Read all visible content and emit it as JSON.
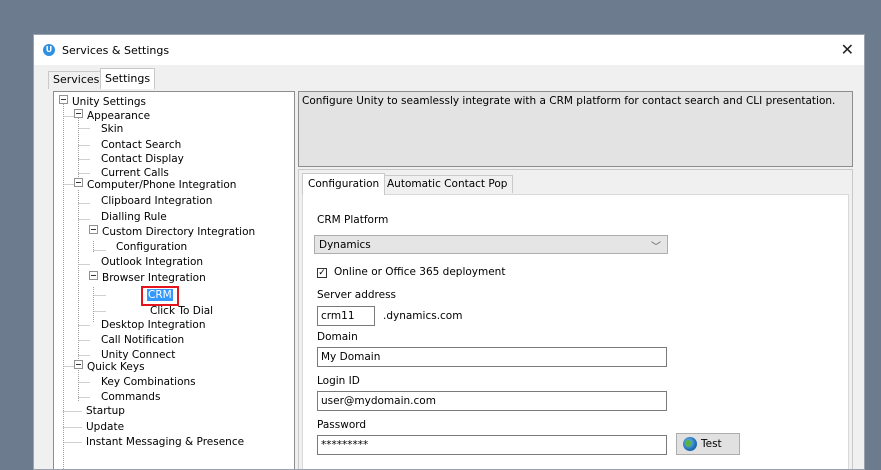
{
  "window": {
    "title": "Services & Settings",
    "app_icon_glyph": "U"
  },
  "top_tabs": [
    {
      "label": "Services"
    },
    {
      "label": "Settings"
    }
  ],
  "tree": {
    "items": [
      {
        "label": "Unity Settings"
      },
      {
        "label": "Appearance"
      },
      {
        "label": "Skin"
      },
      {
        "label": "Contact Search"
      },
      {
        "label": "Contact Display"
      },
      {
        "label": "Current Calls"
      },
      {
        "label": "Computer/Phone Integration"
      },
      {
        "label": "Clipboard Integration"
      },
      {
        "label": "Dialling Rule"
      },
      {
        "label": "Custom Directory Integration"
      },
      {
        "label": "Configuration"
      },
      {
        "label": "Outlook Integration"
      },
      {
        "label": "Browser Integration"
      },
      {
        "label": "CRM"
      },
      {
        "label": "Click To Dial"
      },
      {
        "label": "Desktop Integration"
      },
      {
        "label": "Call Notification"
      },
      {
        "label": "Unity Connect"
      },
      {
        "label": "Quick Keys"
      },
      {
        "label": "Key Combinations"
      },
      {
        "label": "Commands"
      },
      {
        "label": "Startup"
      },
      {
        "label": "Update"
      },
      {
        "label": "Instant Messaging & Presence"
      }
    ]
  },
  "description": "Configure Unity to seamlessly integrate with a CRM platform for contact search and CLI presentation.",
  "inner_tabs": [
    {
      "label": "Configuration"
    },
    {
      "label": "Automatic Contact Pop"
    }
  ],
  "config": {
    "crm_platform_label": "CRM Platform",
    "crm_platform_value": "Dynamics",
    "online_checkbox_label": "Online or Office 365 deployment",
    "online_checked": true,
    "server_address_label": "Server address",
    "server_address_value": "crm11",
    "server_suffix": ".dynamics.com",
    "domain_label": "Domain",
    "domain_value": "My Domain",
    "login_label": "Login ID",
    "login_value": "user@mydomain.com",
    "password_label": "Password",
    "password_value": "*********",
    "test_button_label": "Test"
  },
  "colors": {
    "selection": "#3399ff",
    "highlight_box": "#e3141b",
    "desktop": "#6c7b8d"
  }
}
